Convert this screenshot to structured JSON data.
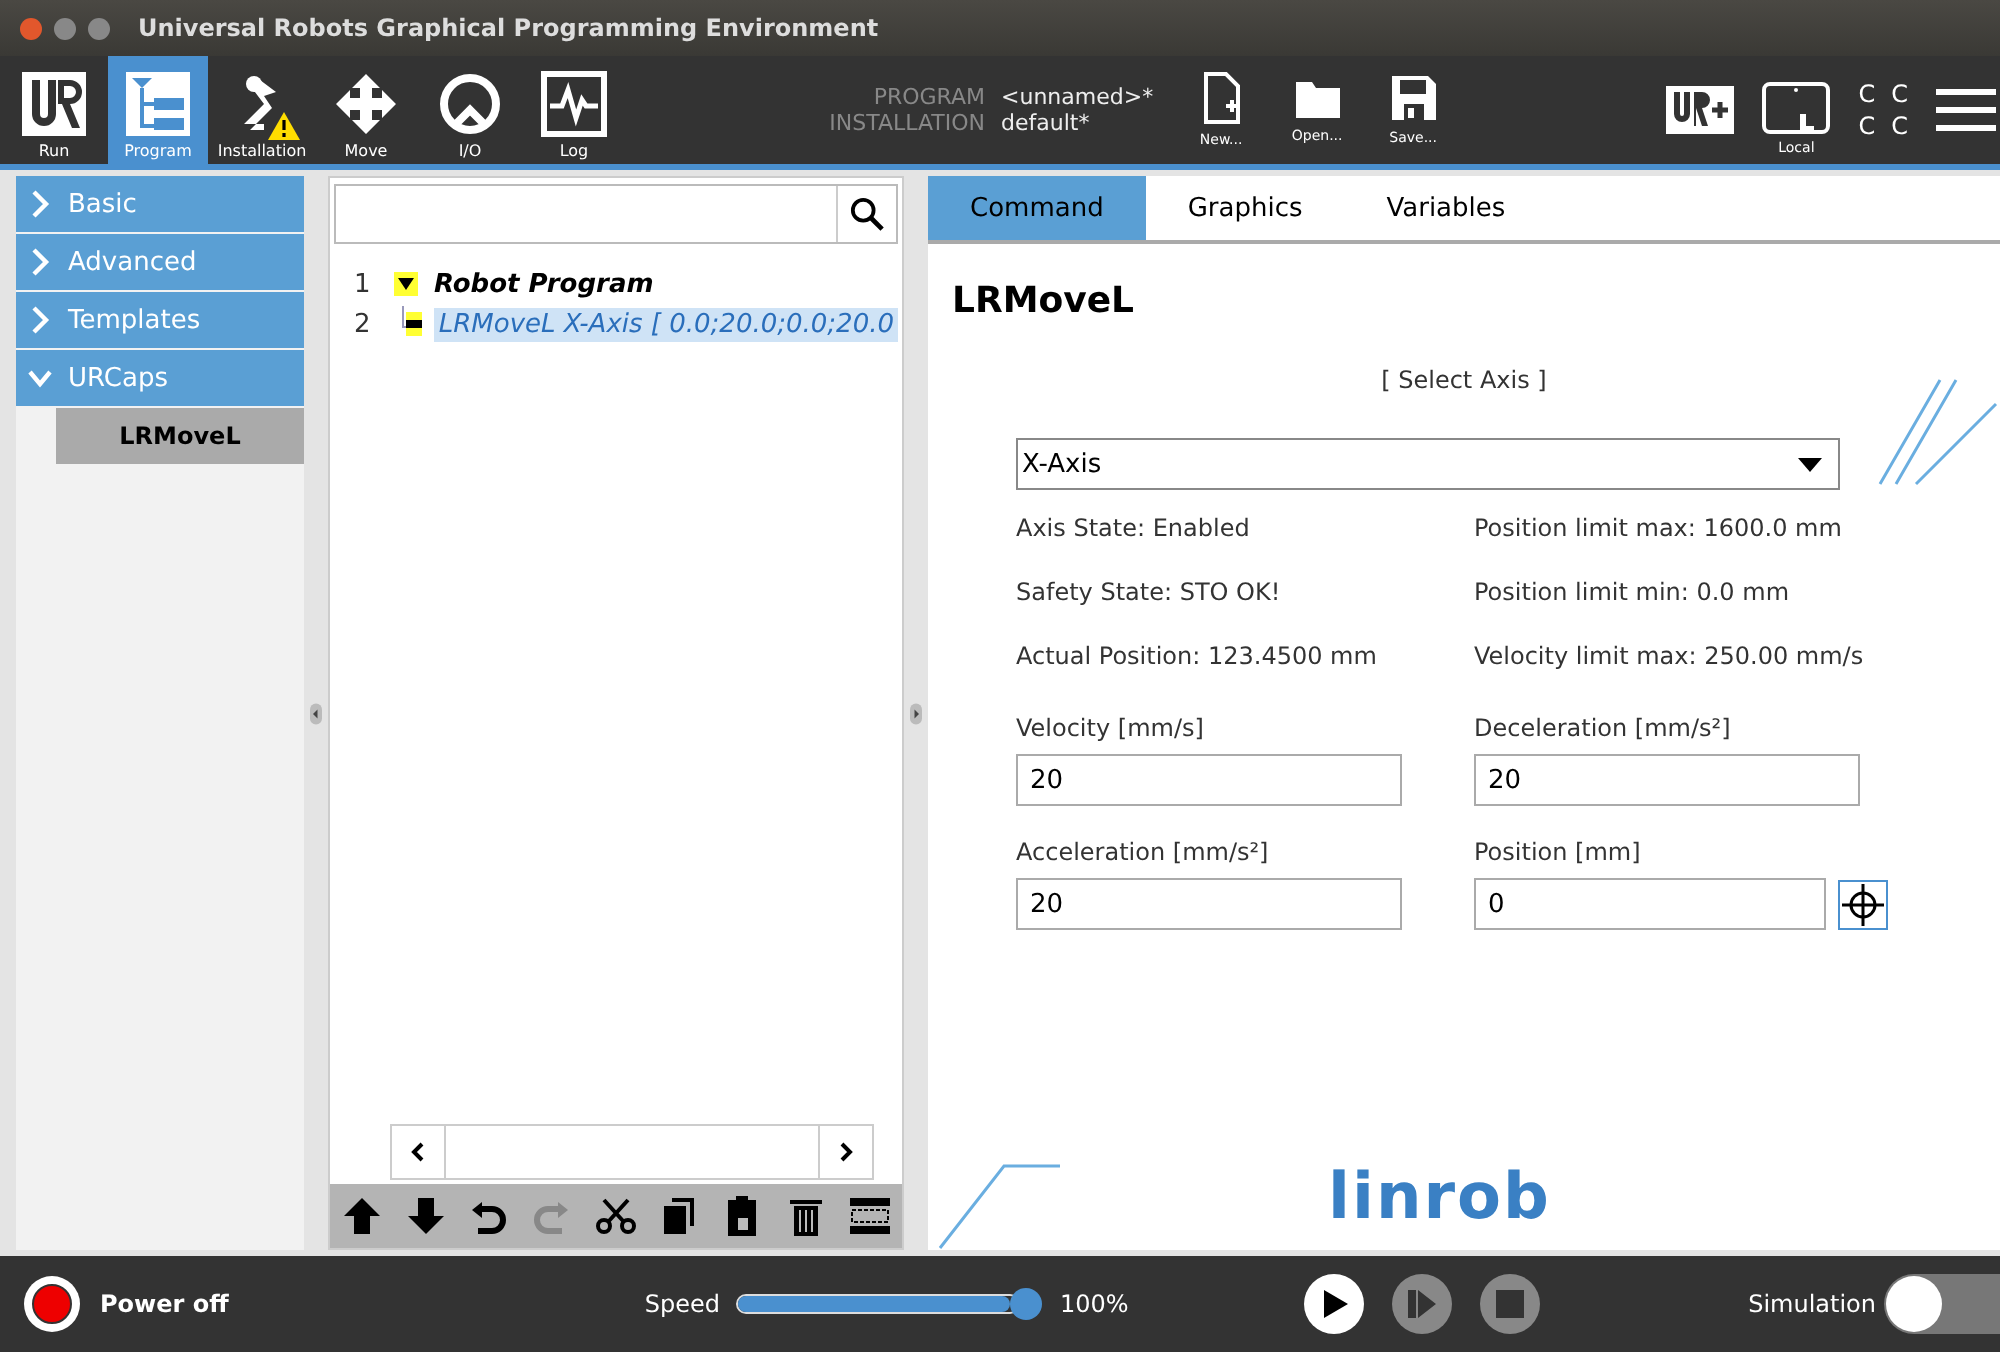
{
  "window": {
    "title": "Universal Robots Graphical Programming Environment"
  },
  "nav_tabs": [
    {
      "label": "Run",
      "selected": false,
      "warning": false
    },
    {
      "label": "Program",
      "selected": true,
      "warning": false
    },
    {
      "label": "Installation",
      "selected": false,
      "warning": true
    },
    {
      "label": "Move",
      "selected": false,
      "warning": false
    },
    {
      "label": "I/O",
      "selected": false,
      "warning": false
    },
    {
      "label": "Log",
      "selected": false,
      "warning": false
    }
  ],
  "program_info": {
    "program_label": "PROGRAM",
    "program": "<unnamed>*",
    "installation_label": "INSTALLATION",
    "installation": "default*"
  },
  "file_buttons": [
    {
      "label": "New..."
    },
    {
      "label": "Open..."
    },
    {
      "label": "Save..."
    }
  ],
  "mode_label": "Local",
  "status_glyphs": [
    "C",
    "C",
    "C",
    "C"
  ],
  "sidebar": {
    "items": [
      {
        "label": "Basic",
        "expanded": false
      },
      {
        "label": "Advanced",
        "expanded": false
      },
      {
        "label": "Templates",
        "expanded": false
      },
      {
        "label": "URCaps",
        "expanded": true,
        "children": [
          {
            "label": "LRMoveL",
            "selected": true
          }
        ]
      }
    ]
  },
  "program_tree": [
    {
      "number": "1",
      "label": "Robot Program",
      "expanded": true,
      "selected": false,
      "children": [
        {
          "number": "2",
          "label": "LRMoveL X-Axis [ 0.0;20.0;0.0;20.0",
          "selected": true
        }
      ]
    }
  ],
  "tree_tools": [
    {
      "disabled": false
    },
    {
      "disabled": false
    },
    {
      "disabled": false
    },
    {
      "disabled": true
    },
    {
      "disabled": false
    },
    {
      "disabled": false
    },
    {
      "disabled": false
    },
    {
      "disabled": false
    },
    {
      "disabled": false
    }
  ],
  "tabs": [
    {
      "label": "Command",
      "selected": true
    },
    {
      "label": "Graphics",
      "selected": false
    },
    {
      "label": "Variables",
      "selected": false
    }
  ],
  "command": {
    "title": "LRMoveL",
    "axis_hint": "[ Select Axis ]",
    "axis": "X-Axis",
    "info": [
      "Axis State: Enabled",
      "Position limit max: 1600.0 mm",
      "Safety State: STO OK!",
      "Position limit min: 0.0 mm",
      "Actual Position: 123.4500 mm",
      "Velocity limit max: 250.00 mm/s"
    ],
    "fields": [
      {
        "label": "Velocity [mm/s]",
        "value": "20",
        "kind": "plain"
      },
      {
        "label": "Deceleration [mm/s²]",
        "value": "20",
        "kind": "plain"
      },
      {
        "label": "Acceleration [mm/s²]",
        "value": "20",
        "kind": "plain"
      },
      {
        "label": "Position [mm]",
        "value": "0",
        "kind": "target"
      }
    ],
    "logo": "linrob"
  },
  "footer": {
    "power": "Power off",
    "speed_label": "Speed",
    "level": 1.0,
    "speed": "100%",
    "controls": [
      {
        "kind": "play",
        "disabled": false
      },
      {
        "kind": "step",
        "disabled": true
      },
      {
        "kind": "stop",
        "disabled": true
      }
    ],
    "simulation_label": "Simulation",
    "simulation_on": false
  }
}
